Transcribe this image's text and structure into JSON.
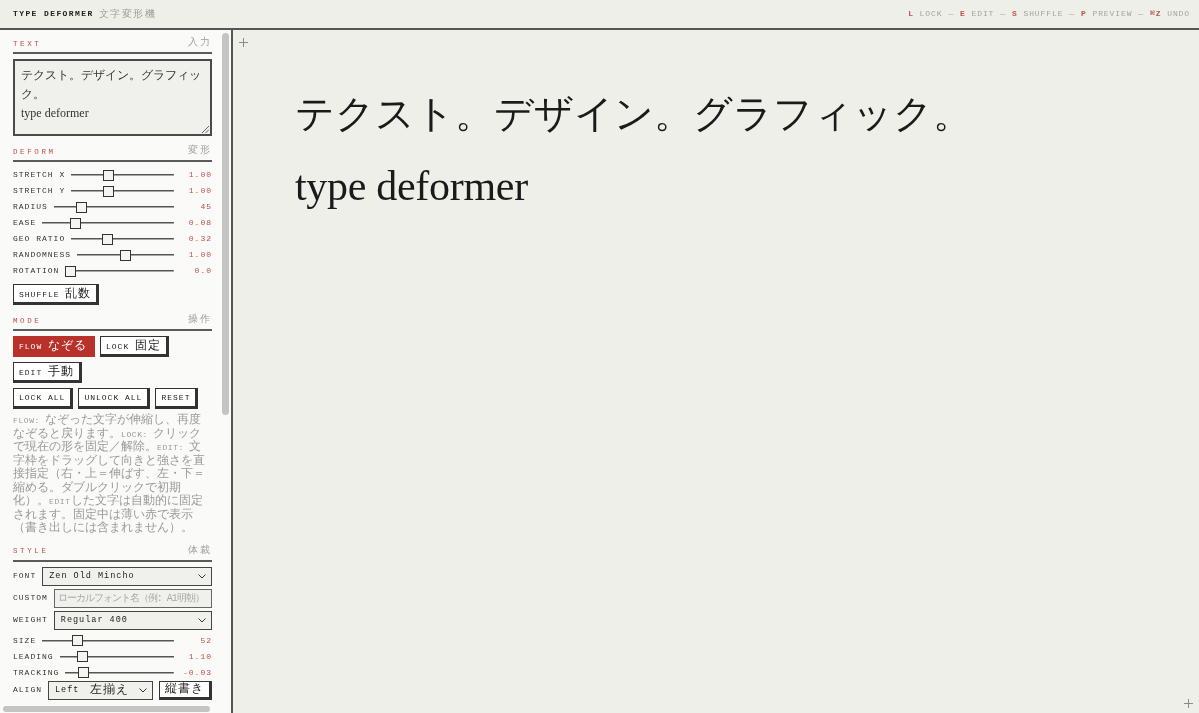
{
  "header": {
    "title": "TYPE DEFORMER",
    "subtitle": "文字変形機",
    "shortcuts": [
      {
        "kind": "key",
        "key": "L",
        "label": "LOCK"
      },
      {
        "kind": "separator",
        "text": "—"
      },
      {
        "kind": "key",
        "key": "E",
        "label": "EDIT"
      },
      {
        "kind": "separator",
        "text": "—"
      },
      {
        "kind": "key",
        "key": "S",
        "label": "SHUFFLE"
      },
      {
        "kind": "separator",
        "text": "—"
      },
      {
        "kind": "key",
        "key": "P",
        "label": "PREVIEW"
      },
      {
        "kind": "separator",
        "text": "—"
      },
      {
        "kind": "key",
        "key": "⌘Z",
        "label": "UNDO"
      }
    ]
  },
  "sidebar": {
    "sections": [
      {
        "kind": "text",
        "title": "TEXT",
        "subtitle": "入力",
        "value": "テクスト。デザイン。グラフィック。\ntype deformer"
      },
      {
        "kind": "deform",
        "title": "DEFORM",
        "subtitle": "変形",
        "sliders": [
          {
            "label": "STRETCH X",
            "level": 0.35,
            "reading": "1.00"
          },
          {
            "label": "STRETCH Y",
            "level": 0.35,
            "reading": "1.00"
          },
          {
            "label": "RADIUS",
            "level": 0.2,
            "reading": "45"
          },
          {
            "label": "EASE",
            "level": 0.23,
            "reading": "0.08"
          },
          {
            "label": "GEO RATIO",
            "level": 0.33,
            "reading": "0.32"
          },
          {
            "label": "RANDOMNESS",
            "level": 0.5,
            "reading": "1.00"
          },
          {
            "label": "ROTATION",
            "level": 0,
            "reading": "0.0"
          }
        ],
        "buttons": [
          "SHUFFLE 乱数"
        ]
      },
      {
        "kind": "mode",
        "title": "MODE",
        "subtitle": "操作",
        "modes": [
          {
            "label": "FLOW なぞる",
            "selected": true
          },
          {
            "label": "LOCK 固定",
            "selected": false
          },
          {
            "label": "EDIT 手動",
            "selected": false
          }
        ],
        "actions": [
          "LOCK ALL",
          "UNLOCK ALL",
          "RESET"
        ],
        "help": "FLOW: なぞった文字が伸縮し、再度なぞると戻ります。LOCK: クリックで現在の形を固定／解除。EDIT: 文字枠をドラッグして向きと強さを直接指定（右・上＝伸ばす、左・下＝縮める。ダブルクリックで初期化）。EDITした文字は自動的に固定されます。固定中は薄い赤で表示（書き出しには含まれません）。"
      },
      {
        "kind": "style",
        "title": "STYLE",
        "subtitle": "体裁",
        "rows": [
          {
            "kind": "select",
            "label": "FONT",
            "value": "Zen Old Mincho"
          },
          {
            "kind": "input",
            "label": "CUSTOM",
            "placeholder": "ローカルフォント名（例: A1明朝）"
          },
          {
            "kind": "select",
            "label": "WEIGHT",
            "value": "Regular 400"
          },
          {
            "kind": "slider",
            "label": "SIZE",
            "level": 0.25,
            "reading": "52"
          },
          {
            "kind": "slider",
            "label": "LEADING",
            "level": 0.17,
            "reading": "1.10"
          },
          {
            "kind": "slider",
            "label": "TRACKING",
            "level": 0.13,
            "reading": "-0.03"
          },
          {
            "kind": "select",
            "label": "ALIGN",
            "value": "Left 左揃え",
            "button": "縦書き"
          }
        ]
      }
    ]
  },
  "preview": {
    "lines": [
      "テクスト。デザイン。グラフィック。",
      "type deformer"
    ]
  }
}
